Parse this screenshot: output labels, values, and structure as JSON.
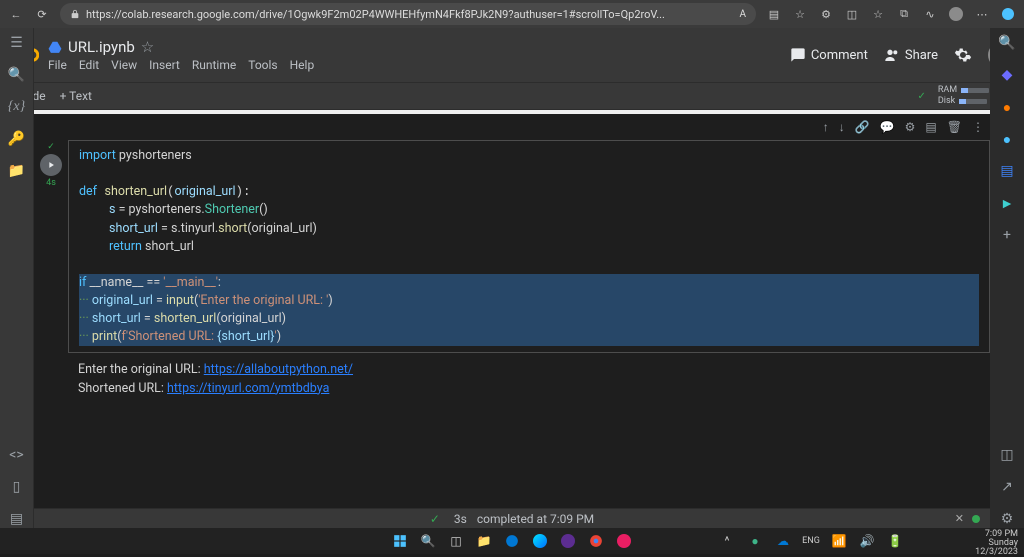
{
  "browser": {
    "url": "https://colab.research.google.com/drive/1Ogwk9F2m02P4WWHEHfymN4Fkf8PJk2N9?authuser=1#scrollTo=Qp2roV...",
    "read_aloud": "A"
  },
  "header": {
    "filename": "URL.ipynb",
    "menu": [
      "File",
      "Edit",
      "View",
      "Insert",
      "Runtime",
      "Tools",
      "Help"
    ],
    "comment": "Comment",
    "share": "Share"
  },
  "toolbar": {
    "code": "+ Code",
    "text": "+ Text",
    "ram": "RAM",
    "disk": "Disk"
  },
  "cell": {
    "duration": "4s",
    "code": {
      "l1a": "import",
      "l1b": " pyshorteners",
      "l2a": "def",
      "l2b": "shorten_url",
      "l2c": "original_url",
      "l3a": "s ",
      "l3b": "= pyshorteners.",
      "l3c": "Shortener",
      "l3d": "()",
      "l4a": "short_url ",
      "l4b": "= s.tinyurl.",
      "l4c": "short",
      "l4d": "(original_url)",
      "l5a": "return",
      "l5b": " short_url",
      "l6a": "if",
      "l6b": " __name__ ",
      "l6c": "== ",
      "l6d": "'__main__'",
      "l6e": ":",
      "l7a": "···",
      "l7b": "original_url ",
      "l7c": "= ",
      "l7d": "input",
      "l7e": "(",
      "l7f": "'Enter the original URL: '",
      "l7g": ")",
      "l8a": "···",
      "l8b": "short_url ",
      "l8c": "= ",
      "l8d": "shorten_url",
      "l8e": "(original_url)",
      "l9a": "···",
      "l9b": "print",
      "l9c": "(",
      "l9d": "f'Shortened URL: ",
      "l9e": "{short_url}",
      "l9f": "'",
      "l9g": ")"
    },
    "output": {
      "l1a": "Enter the original URL: ",
      "l1_link": "https://allaboutpython.net/",
      "l2a": "Shortened URL: ",
      "l2_link": "https://tinyurl.com/ymtbdbya"
    }
  },
  "status": {
    "seconds": "3s",
    "msg": "completed at 7:09 PM"
  },
  "clock": {
    "time": "7:09 PM",
    "day": "Sunday",
    "date": "12/3/2023"
  }
}
